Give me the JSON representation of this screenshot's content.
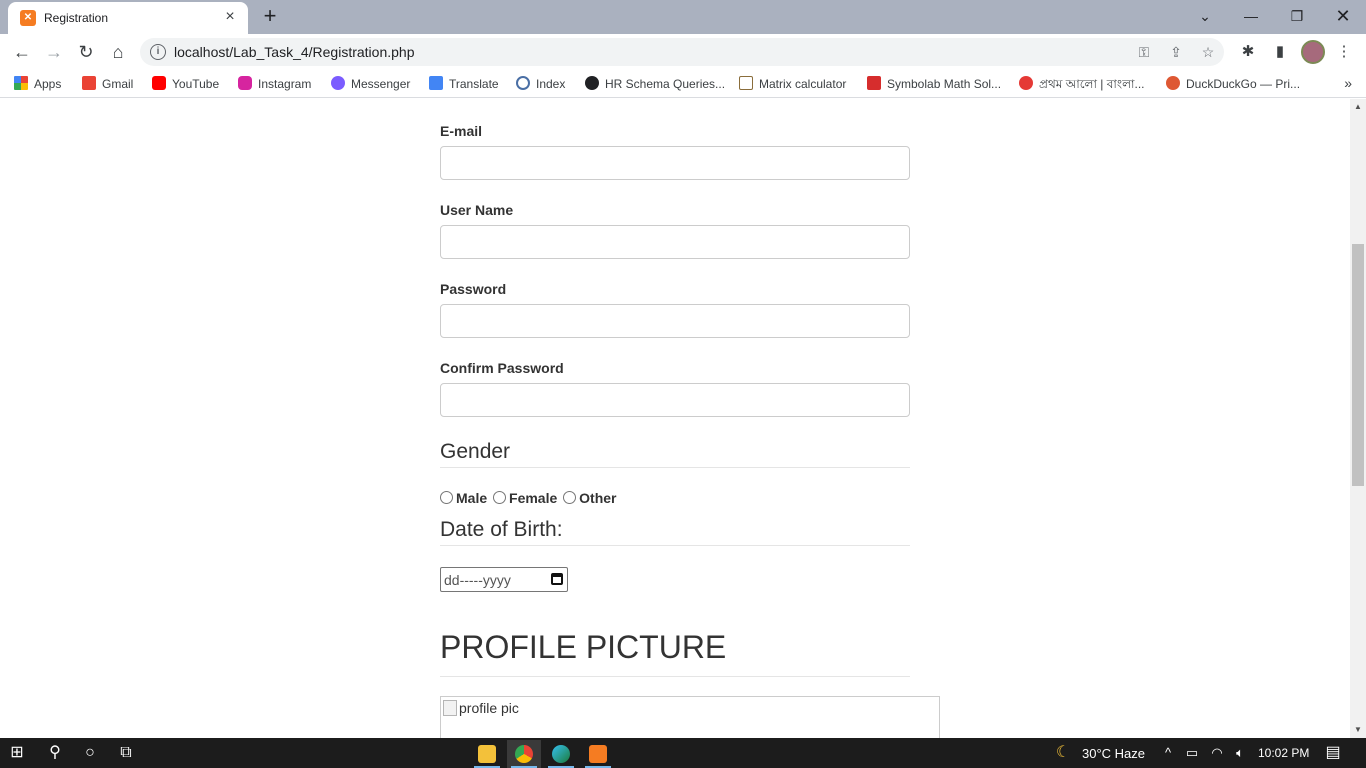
{
  "browser": {
    "tab": {
      "title": "Registration",
      "favicon": "xampp-icon"
    },
    "url": "localhost/Lab_Task_4/Registration.php",
    "window_controls": [
      "minimize",
      "restore",
      "close"
    ]
  },
  "bookmarks": [
    {
      "label": "Apps",
      "icon": "apps-grid-icon",
      "color": "#e94235"
    },
    {
      "label": "Gmail",
      "icon": "gmail-icon",
      "color": "#ea4335"
    },
    {
      "label": "YouTube",
      "icon": "youtube-icon",
      "color": "#ff0000"
    },
    {
      "label": "Instagram",
      "icon": "instagram-icon",
      "color": "#d6249f"
    },
    {
      "label": "Messenger",
      "icon": "messenger-icon",
      "color": "#7b5cff"
    },
    {
      "label": "Translate",
      "icon": "translate-icon",
      "color": "#4285f4"
    },
    {
      "label": "Index",
      "icon": "index-icon",
      "color": "#4a6fa5"
    },
    {
      "label": "HR Schema Queries...",
      "icon": "globe-icon",
      "color": "#202124"
    },
    {
      "label": "Matrix calculator",
      "icon": "matrix-icon",
      "color": "#8a6d3b"
    },
    {
      "label": "Symbolab Math Sol...",
      "icon": "symbolab-icon",
      "color": "#d62d2d"
    },
    {
      "label": "প্রথম আলো | বাংলা...",
      "icon": "prothomalo-icon",
      "color": "#e53935"
    },
    {
      "label": "DuckDuckGo — Pri...",
      "icon": "duckduckgo-icon",
      "color": "#de5833"
    }
  ],
  "form": {
    "email_label": "E-mail",
    "username_label": "User Name",
    "password_label": "Password",
    "confirm_password_label": "Confirm Password",
    "gender_legend": "Gender",
    "gender_options": [
      "Male",
      "Female",
      "Other"
    ],
    "dob_legend": "Date of Birth:",
    "dob_placeholder": "dd-----yyyy",
    "profile_heading": "PROFILE PICTURE",
    "profile_img_alt": "profile pic"
  },
  "taskbar": {
    "weather": "30°C  Haze",
    "time": "10:02 PM",
    "apps": [
      "file-explorer-icon",
      "chrome-icon",
      "edge-icon",
      "xampp-icon"
    ]
  },
  "colors": {
    "tabstrip": "#aab1bf",
    "text": "#333333",
    "field_border": "#cccccc",
    "taskbar": "#1c1c1c"
  }
}
